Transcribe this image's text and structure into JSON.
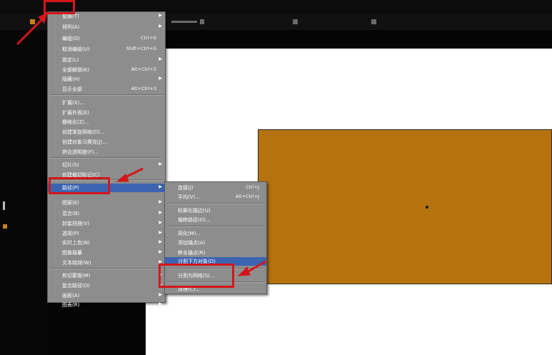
{
  "object_menu": {
    "title": "对象",
    "items": [
      {
        "label": "变换(T)",
        "shortcut": "",
        "submenu": true
      },
      {
        "label": "排列(A)",
        "shortcut": "",
        "submenu": true
      },
      {
        "label": "编组(G)",
        "shortcut": "Ctrl+G",
        "submenu": false
      },
      {
        "label": "取消编组(U)",
        "shortcut": "Shift+Ctrl+G",
        "submenu": false
      },
      {
        "label": "锁定(L)",
        "shortcut": "",
        "submenu": true
      },
      {
        "label": "全部解锁(K)",
        "shortcut": "Alt+Ctrl+2",
        "submenu": false
      },
      {
        "label": "隐藏(H)",
        "shortcut": "",
        "submenu": true
      },
      {
        "label": "显示全部",
        "shortcut": "Alt+Ctrl+3",
        "submenu": false
      },
      {
        "label": "扩展(X)...",
        "shortcut": "",
        "submenu": false
      },
      {
        "label": "扩展外观(E)",
        "shortcut": "",
        "submenu": false
      },
      {
        "label": "栅格化(Z)...",
        "shortcut": "",
        "submenu": false
      },
      {
        "label": "创建渐变网格(D)...",
        "shortcut": "",
        "submenu": false
      },
      {
        "label": "创建对象马赛克(J)...",
        "shortcut": "",
        "submenu": false
      },
      {
        "label": "拼合透明度(F)...",
        "shortcut": "",
        "submenu": false
      },
      {
        "label": "切片(S)",
        "shortcut": "",
        "submenu": true
      },
      {
        "label": "创建裁切标记(C)",
        "shortcut": "",
        "submenu": false
      },
      {
        "label": "路径(P)",
        "shortcut": "",
        "submenu": true
      },
      {
        "label": "图案(E)",
        "shortcut": "",
        "submenu": true
      },
      {
        "label": "混合(B)",
        "shortcut": "",
        "submenu": true
      },
      {
        "label": "封套扭曲(V)",
        "shortcut": "",
        "submenu": true
      },
      {
        "label": "透视(P)",
        "shortcut": "",
        "submenu": true
      },
      {
        "label": "实时上色(N)",
        "shortcut": "",
        "submenu": true
      },
      {
        "label": "图像描摹",
        "shortcut": "",
        "submenu": true
      },
      {
        "label": "文本绕排(W)",
        "shortcut": "",
        "submenu": true
      },
      {
        "label": "剪切蒙版(M)",
        "shortcut": "",
        "submenu": true
      },
      {
        "label": "复合路径(O)",
        "shortcut": "",
        "submenu": true
      },
      {
        "label": "画板(A)",
        "shortcut": "",
        "submenu": true
      },
      {
        "label": "图表(R)",
        "shortcut": "",
        "submenu": true
      }
    ]
  },
  "path_submenu": {
    "items": [
      {
        "label": "连接(J)",
        "shortcut": "Ctrl+J"
      },
      {
        "label": "平均(V)...",
        "shortcut": "Alt+Ctrl+J"
      },
      {
        "label": "轮廓化描边(U)",
        "shortcut": ""
      },
      {
        "label": "偏移路径(O)...",
        "shortcut": ""
      },
      {
        "label": "简化(M)...",
        "shortcut": ""
      },
      {
        "label": "添加锚点(A)",
        "shortcut": ""
      },
      {
        "label": "移去锚点(R)",
        "shortcut": ""
      },
      {
        "label": "分割下方对象(D)",
        "shortcut": ""
      },
      {
        "label": "分割为网格(S)...",
        "shortcut": ""
      },
      {
        "label": "清理(C)...",
        "shortcut": ""
      }
    ]
  },
  "colors": {
    "rectangle_fill": "#b5720f",
    "menu_bg": "#8d8d8d",
    "highlight": "#3c64b0",
    "annotation": "#d4161b"
  }
}
